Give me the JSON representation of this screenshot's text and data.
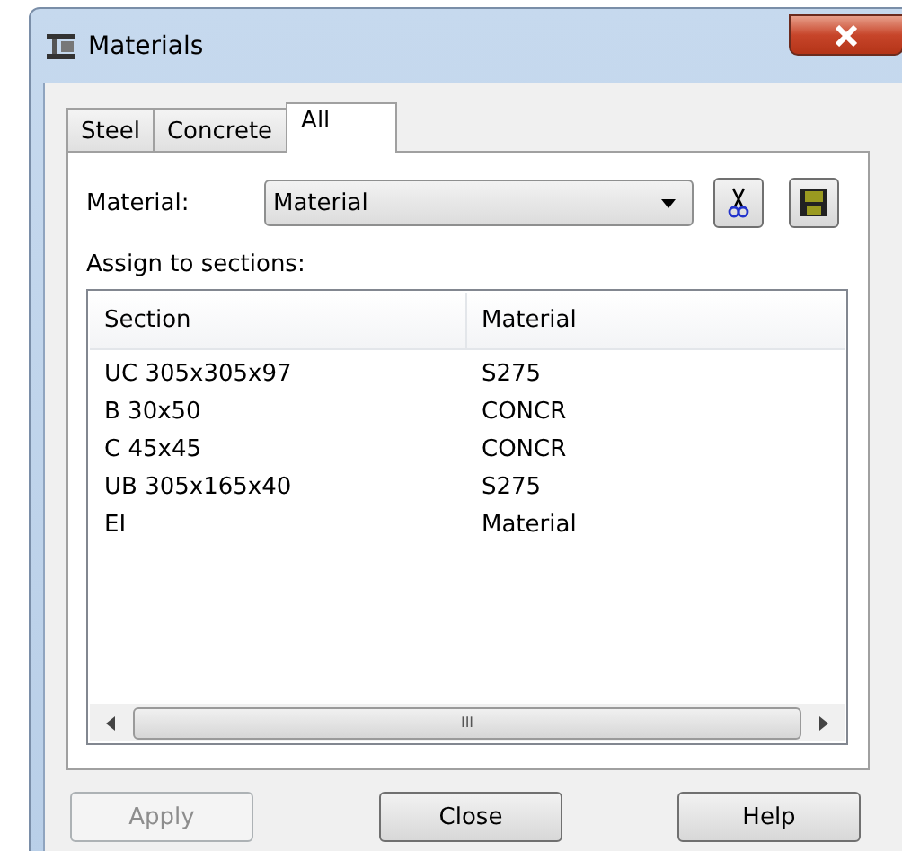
{
  "window": {
    "title": "Materials"
  },
  "tabs": [
    {
      "label": "Steel",
      "selected": false
    },
    {
      "label": "Concrete",
      "selected": false
    },
    {
      "label": "All",
      "selected": true
    }
  ],
  "material_field": {
    "label": "Material:",
    "value": "Material"
  },
  "assign_label": "Assign to sections:",
  "table": {
    "columns": [
      "Section",
      "Material"
    ],
    "rows": [
      [
        "UC 305x305x97",
        "S275"
      ],
      [
        "B 30x50",
        "CONCR"
      ],
      [
        "C 45x45",
        "CONCR"
      ],
      [
        "UB 305x165x40",
        "S275"
      ],
      [
        "EI",
        "Material"
      ]
    ]
  },
  "scrollbar_grip": "III",
  "buttons": [
    {
      "label": "Apply",
      "disabled": true
    },
    {
      "label": "Close",
      "disabled": false
    },
    {
      "label": "Help",
      "disabled": false
    }
  ]
}
